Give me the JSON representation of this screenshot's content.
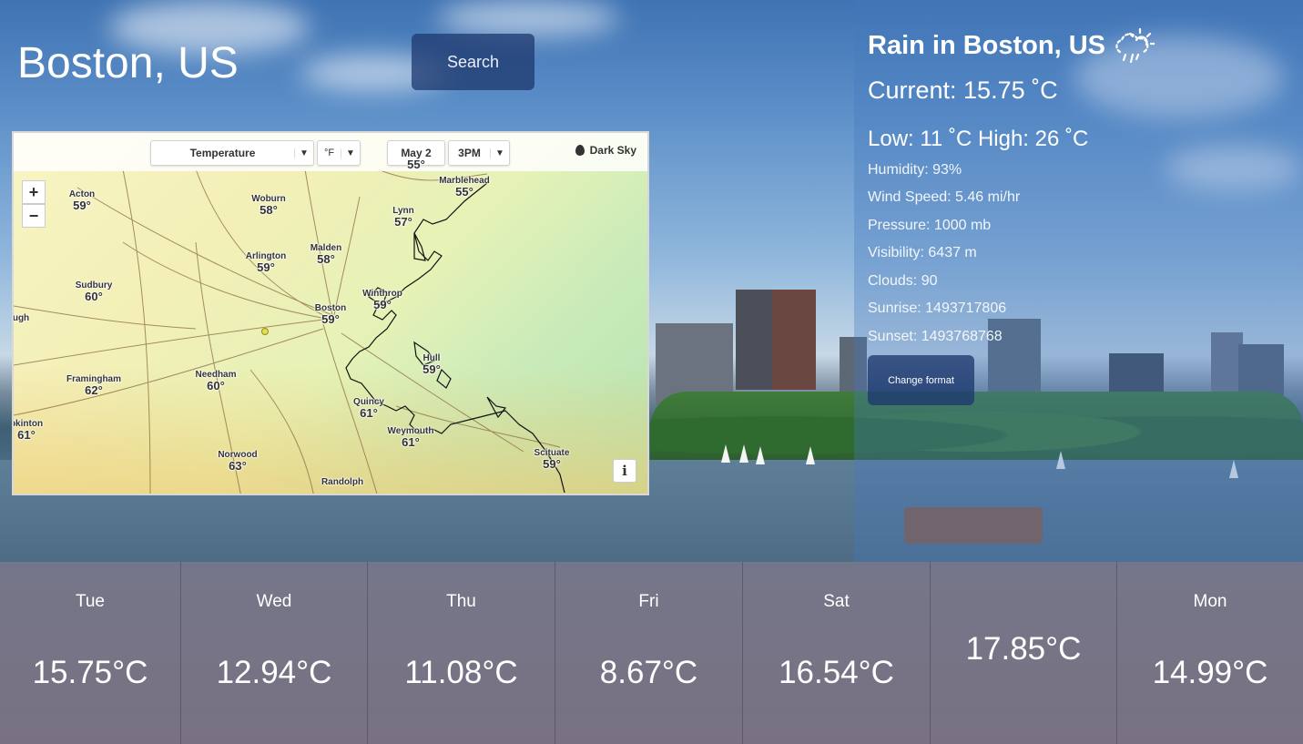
{
  "header": {
    "city": "Boston, US",
    "search_label": "Search"
  },
  "map": {
    "layer_select": "Temperature",
    "unit_select": "°F",
    "date_select": "May 2",
    "time_select": "3PM",
    "brand": "Dark Sky",
    "zoom_in": "+",
    "zoom_out": "−",
    "info": "i",
    "places": [
      {
        "name": "Acton",
        "temp": "59°"
      },
      {
        "name": "Woburn",
        "temp": "58°"
      },
      {
        "name": "Marblehead",
        "temp": "55°"
      },
      {
        "name": "Lynn",
        "temp": "57°"
      },
      {
        "name": "Malden",
        "temp": "58°"
      },
      {
        "name": "Arlington",
        "temp": "59°"
      },
      {
        "name": "Sudbury",
        "temp": "60°"
      },
      {
        "name": "Winthrop",
        "temp": "59°"
      },
      {
        "name": "Boston",
        "temp": "59°"
      },
      {
        "name": "ugh",
        "temp": ""
      },
      {
        "name": "Hull",
        "temp": "59°"
      },
      {
        "name": "Framingham",
        "temp": "62°"
      },
      {
        "name": "Needham",
        "temp": "60°"
      },
      {
        "name": "Quincy",
        "temp": "61°"
      },
      {
        "name": "Weymouth",
        "temp": "61°"
      },
      {
        "name": "pkinton",
        "temp": "61°"
      },
      {
        "name": "Norwood",
        "temp": "63°"
      },
      {
        "name": "Scituate",
        "temp": "59°"
      },
      {
        "name": "Randolph",
        "temp": ""
      },
      {
        "name": "",
        "temp": "55°"
      }
    ]
  },
  "details": {
    "heading": "Rain in Boston, US",
    "current": "Current: 15.75 ˚C",
    "low_high": "Low: 11 ˚C High: 26 ˚C",
    "humidity": "Humidity: 93%",
    "wind": "Wind Speed: 5.46 mi/hr",
    "pressure": "Pressure: 1000 mb",
    "visibility": "Visibility: 6437 m",
    "clouds": "Clouds: 90",
    "sunrise": "Sunrise: 1493717806",
    "sunset": "Sunset: 1493768768",
    "change_format_label": "Change format",
    "weather_icon": "rain-cloud-sun-icon"
  },
  "forecast": [
    {
      "day": "Tue",
      "temp": "15.75°C"
    },
    {
      "day": "Wed",
      "temp": "12.94°C"
    },
    {
      "day": "Thu",
      "temp": "11.08°C"
    },
    {
      "day": "Fri",
      "temp": "8.67°C"
    },
    {
      "day": "Sat",
      "temp": "16.54°C"
    },
    {
      "day": "",
      "temp": "17.85°C"
    },
    {
      "day": "Mon",
      "temp": "14.99°C"
    }
  ],
  "colors": {
    "button_bg": "#1e386e",
    "text": "#ffffff"
  }
}
